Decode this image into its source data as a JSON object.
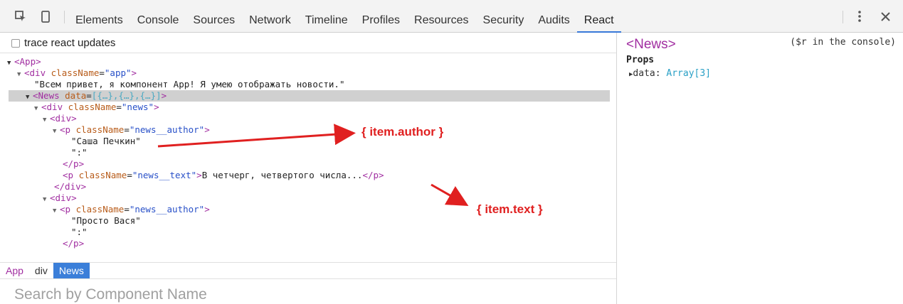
{
  "toolbar": {
    "inspect_icon": "cursor-select-icon",
    "device_icon": "mobile-device-icon",
    "tabs": [
      "Elements",
      "Console",
      "Sources",
      "Network",
      "Timeline",
      "Profiles",
      "Resources",
      "Security",
      "Audits",
      "React"
    ],
    "active_tab": "React",
    "more_icon": "vertical-dots-icon",
    "close_icon": "close-icon"
  },
  "left_pane": {
    "trace_label": "trace react updates",
    "tree": {
      "l1": {
        "tag_open": "<App>"
      },
      "l2": {
        "tag": "<div ",
        "attr": "className",
        "eq": "=",
        "val": "\"app\"",
        "close": ">"
      },
      "l3": {
        "text": "\"Всем привет, я компонент App! Я умею отображать новости.\""
      },
      "l4": {
        "tag": "<News ",
        "attr": "data",
        "eq": "=",
        "val": "[{…},{…},{…}]",
        "close": ">"
      },
      "l5": {
        "tag": "<div ",
        "attr": "className",
        "eq": "=",
        "val": "\"news\"",
        "close": ">"
      },
      "l6": {
        "tag": "<div>"
      },
      "l7": {
        "tag": "<p ",
        "attr": "className",
        "eq": "=",
        "val": "\"news__author\"",
        "close": ">"
      },
      "l8": {
        "text": "\"Саша Печкин\""
      },
      "l9": {
        "text": "\":\""
      },
      "l10": {
        "tag": "</p>"
      },
      "l11": {
        "tag": "<p ",
        "attr": "className",
        "eq": "=",
        "val": "\"news__text\"",
        "close": ">",
        "text": "В четчерг, четвертого числа...",
        "end": "</p>"
      },
      "l12": {
        "tag": "</div>"
      },
      "l13": {
        "tag": "<div>"
      },
      "l14": {
        "tag": "<p ",
        "attr": "className",
        "eq": "=",
        "val": "\"news__author\"",
        "close": ">"
      },
      "l15": {
        "text": "\"Просто Вася\""
      },
      "l16": {
        "text": "\":\""
      },
      "l17": {
        "tag": "</p>"
      }
    },
    "breadcrumbs": [
      "App",
      "div",
      "News"
    ],
    "active_crumb": "News",
    "search_placeholder": "Search by Component Name"
  },
  "right_pane": {
    "title": "<News>",
    "hint": "($r in the console)",
    "props_label": "Props",
    "data_key": "data: ",
    "data_value": "Array[3]"
  },
  "annotations": {
    "author": "{ item.author }",
    "text": "{ item.text }"
  },
  "colors": {
    "accent_tab": "#3879d9",
    "tag": "#a12ea1",
    "attr": "#b85c1a",
    "attr_value": "#2850c8",
    "annotation": "#e02020"
  }
}
